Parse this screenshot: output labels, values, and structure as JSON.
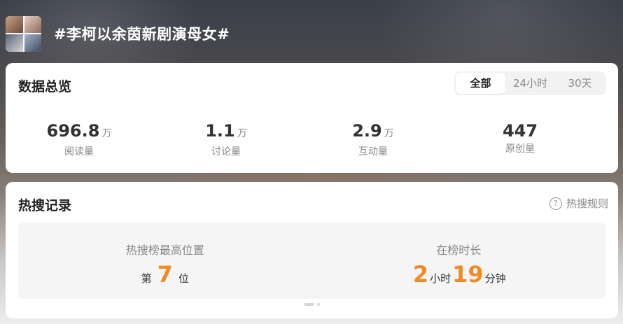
{
  "topic": {
    "title": "#李柯以余茵新剧演母女#"
  },
  "overview": {
    "title": "数据总览",
    "tabs": [
      {
        "label": "全部",
        "active": true
      },
      {
        "label": "24小时",
        "active": false
      },
      {
        "label": "30天",
        "active": false
      }
    ],
    "stats": [
      {
        "value": "696.8",
        "unit": "万",
        "label": "阅读量"
      },
      {
        "value": "1.1",
        "unit": "万",
        "label": "讨论量"
      },
      {
        "value": "2.9",
        "unit": "万",
        "label": "互动量"
      },
      {
        "value": "447",
        "unit": "",
        "label": "原创量"
      }
    ]
  },
  "hot": {
    "title": "热搜记录",
    "rules_label": "热搜规则",
    "rules_icon": "question-circle-icon",
    "peak": {
      "label": "热搜榜最高位置",
      "prefix": "第",
      "value": "7",
      "suffix": "位"
    },
    "duration": {
      "label": "在榜时长",
      "hours": "2",
      "hours_unit": "小时",
      "minutes": "19",
      "minutes_unit": "分钟"
    },
    "accent_color": "#f08a24"
  }
}
